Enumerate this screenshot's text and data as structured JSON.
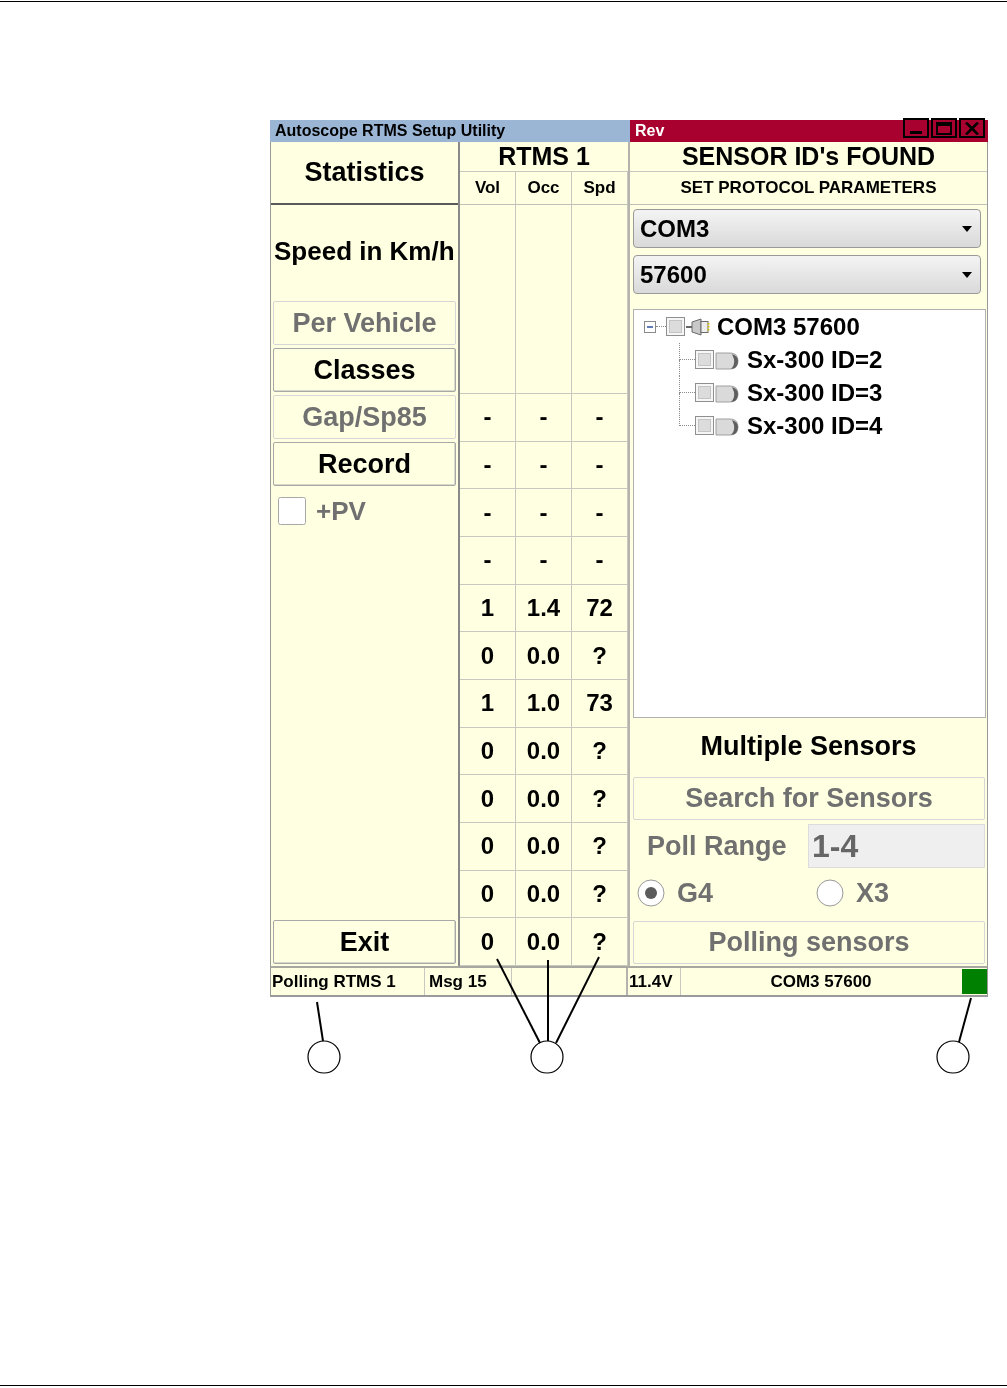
{
  "title_bar": {
    "title": "Autoscope RTMS Setup Utility",
    "caption": "Rev"
  },
  "statistics": {
    "heading": "Statistics",
    "unit_label": "Speed in Km/h",
    "buttons": [
      {
        "label": "Per Vehicle",
        "disabled": true
      },
      {
        "label": "Classes",
        "disabled": false
      },
      {
        "label": "Gap/Sp85",
        "disabled": true
      },
      {
        "label": "Record",
        "disabled": false
      }
    ],
    "plus_pv": {
      "label": "+PV",
      "checked": false,
      "disabled": true
    },
    "exit_button": {
      "label": "Exit",
      "disabled": false
    }
  },
  "table": {
    "title": "RTMS 1",
    "columns": [
      "Vol",
      "Occ",
      "Spd"
    ],
    "rows": [
      [
        "-",
        "-",
        "-"
      ],
      [
        "-",
        "-",
        "-"
      ],
      [
        "-",
        "-",
        "-"
      ],
      [
        "-",
        "-",
        "-"
      ],
      [
        "1",
        "1.4",
        "72"
      ],
      [
        "0",
        "0.0",
        "?"
      ],
      [
        "1",
        "1.0",
        "73"
      ],
      [
        "0",
        "0.0",
        "?"
      ],
      [
        "0",
        "0.0",
        "?"
      ],
      [
        "0",
        "0.0",
        "?"
      ],
      [
        "0",
        "0.0",
        "?"
      ],
      [
        "0",
        "0.0",
        "?"
      ]
    ]
  },
  "sensors": {
    "heading": "SENSOR ID's FOUND",
    "subheading": "SET PROTOCOL PARAMETERS",
    "port_dropdown": {
      "value": "COM3"
    },
    "baud_dropdown": {
      "value": "57600"
    },
    "tree": [
      {
        "label": "COM3 57600",
        "kind": "port",
        "expanded": true,
        "checked": false,
        "children": [
          {
            "label": "Sx-300 ID=2",
            "kind": "sensor",
            "checked": false
          },
          {
            "label": "Sx-300 ID=3",
            "kind": "sensor",
            "checked": false
          },
          {
            "label": "Sx-300 ID=4",
            "kind": "sensor",
            "checked": false
          }
        ]
      }
    ],
    "multiple_heading": "Multiple Sensors",
    "search_button": {
      "label": "Search for Sensors",
      "disabled": true
    },
    "poll_range": {
      "label": "Poll Range",
      "value": "1-4",
      "disabled": true
    },
    "protocols": [
      {
        "label": "G4",
        "selected": true,
        "disabled": true
      },
      {
        "label": "X3",
        "selected": false,
        "disabled": true
      }
    ],
    "polling_button": {
      "label": "Polling sensors",
      "disabled": true
    }
  },
  "status_bar": {
    "message": "Polling RTMS 1",
    "msg_count": "Msg 15",
    "voltage": "11.4V",
    "connection": "COM3 57600",
    "connected": true
  }
}
